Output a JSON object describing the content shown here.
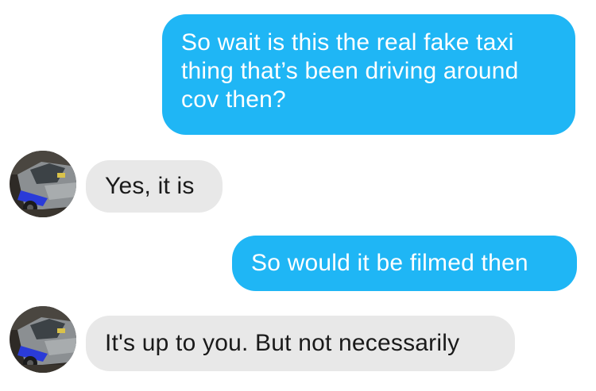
{
  "conversation": {
    "messages": [
      {
        "direction": "outgoing",
        "text": "So wait is this the real fake taxi thing that’s been driving around cov then?"
      },
      {
        "direction": "incoming",
        "text": "Yes, it is"
      },
      {
        "direction": "outgoing",
        "text": "So would it be filmed then"
      },
      {
        "direction": "incoming",
        "text": "It's up to you. But not necessarily"
      }
    ],
    "contact_avatar": "taxi-photo-avatar"
  },
  "colors": {
    "outgoing_bubble": "#1fb6f5",
    "incoming_bubble": "#e8e8e8",
    "background": "#ffffff"
  }
}
